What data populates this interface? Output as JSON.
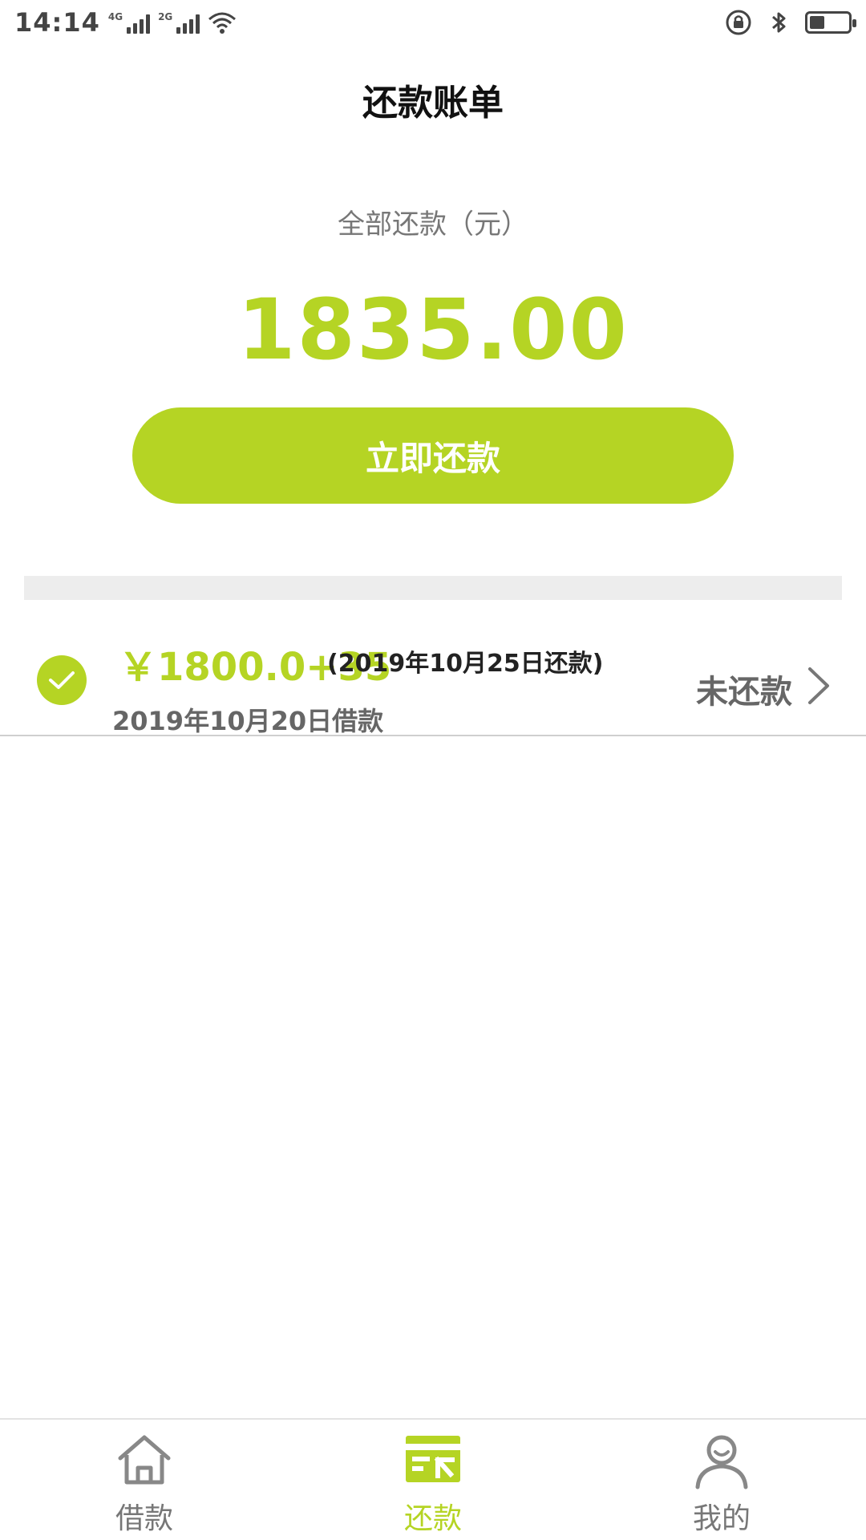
{
  "status_bar": {
    "time": "14:14",
    "network_1": "4G",
    "network_2": "2G",
    "icons": [
      "signal-icon",
      "wifi-icon",
      "lock-rotation-icon",
      "bluetooth-icon",
      "battery-icon"
    ],
    "battery_level": 0.4
  },
  "header": {
    "title": "还款账单"
  },
  "summary": {
    "label": "全部还款（元）",
    "amount": "1835.00",
    "button_label": "立即还款"
  },
  "bill": {
    "amount": "￥1800.0+35",
    "due": "(2019年10月25日还款)",
    "borrow_date": "2019年10月20日借款",
    "status": "未还款"
  },
  "bottom_nav": {
    "items": [
      {
        "label": "借款",
        "icon": "home-icon"
      },
      {
        "label": "还款",
        "icon": "repay-card-icon"
      },
      {
        "label": "我的",
        "icon": "user-icon"
      }
    ],
    "active_index": 1
  },
  "colors": {
    "accent": "#b5d424",
    "text_gray": "#777777",
    "divider": "#ededed"
  }
}
